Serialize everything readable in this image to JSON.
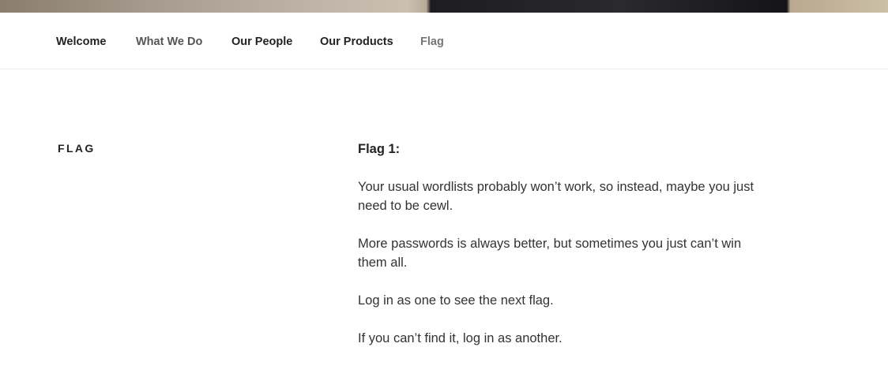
{
  "nav": {
    "items": [
      {
        "label": "Welcome"
      },
      {
        "label": "What We Do"
      },
      {
        "label": "Our People"
      },
      {
        "label": "Our Products"
      },
      {
        "label": "Flag"
      }
    ]
  },
  "page": {
    "title": "FLAG",
    "heading": "Flag 1:",
    "paragraphs": [
      "Your usual wordlists probably won’t work, so instead, maybe you just need to be cewl.",
      "More passwords is always better, but sometimes you just can’t win them all.",
      "Log in as one to see the next flag.",
      "If you can’t find it, log in as another."
    ]
  },
  "colors": {
    "text": "#222222",
    "muted_nav": "#555555",
    "current_nav": "#767676",
    "border": "#eeeeee"
  }
}
